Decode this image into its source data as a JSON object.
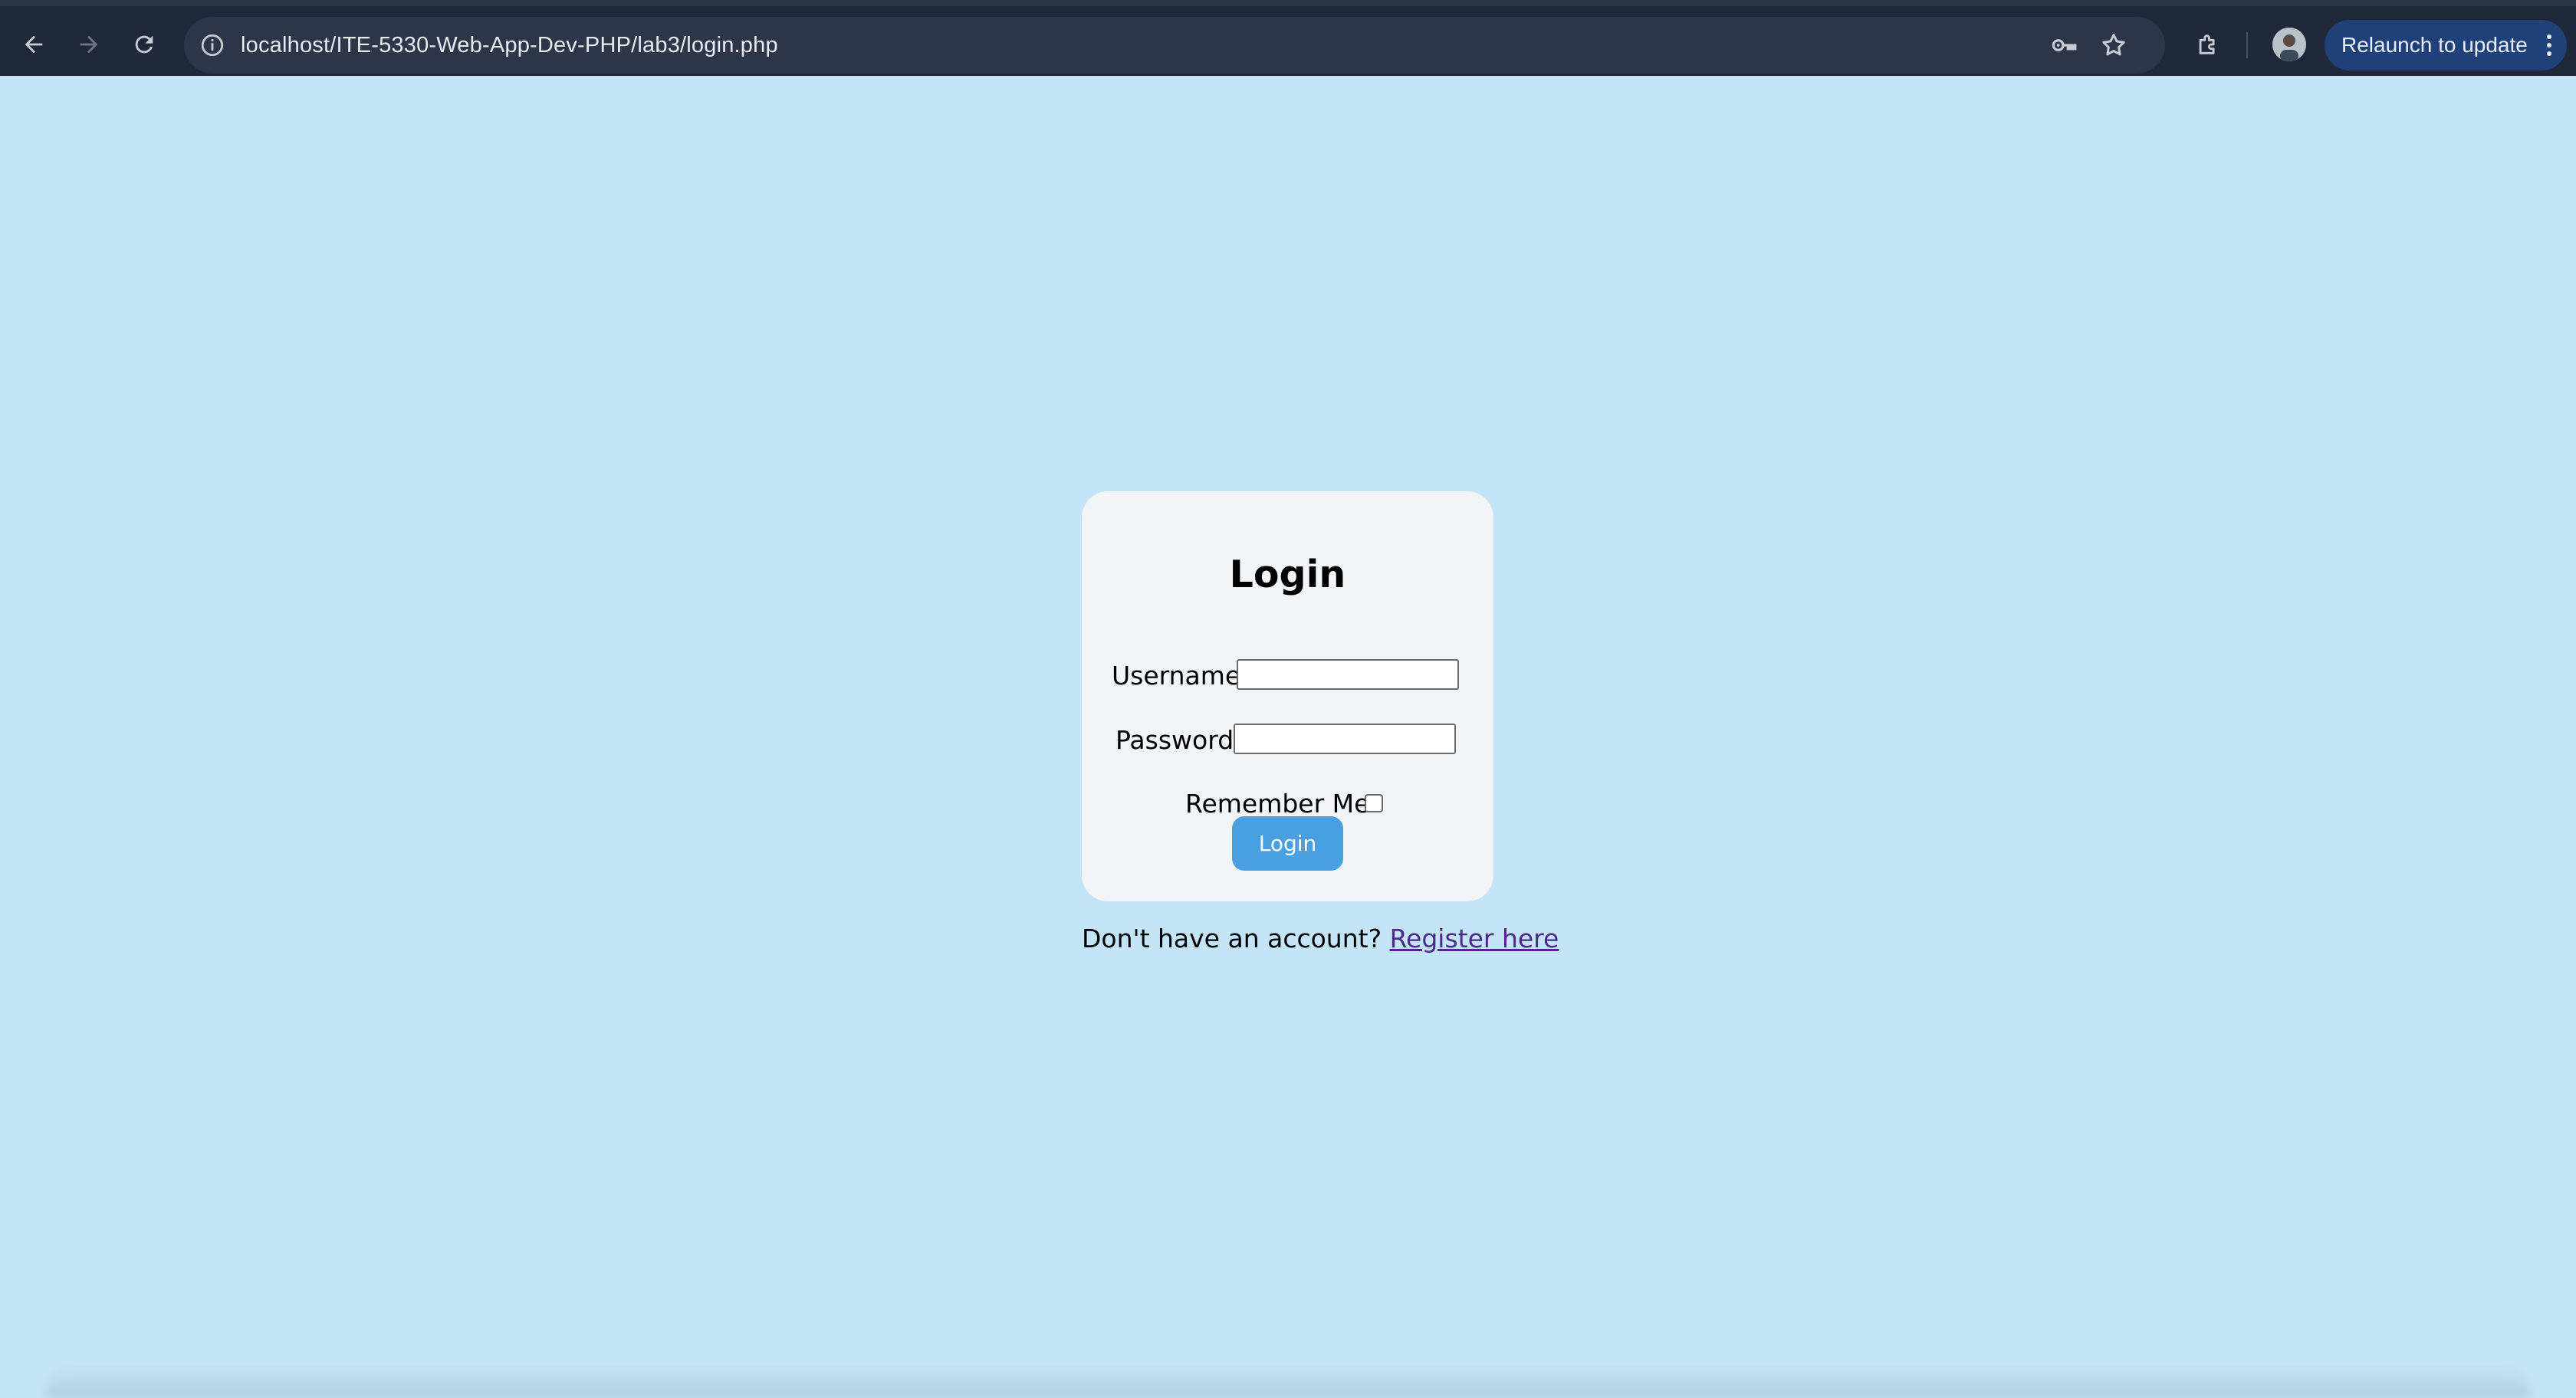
{
  "browser": {
    "url": "localhost/ITE-5330-Web-App-Dev-PHP/lab3/login.php",
    "relaunch_label": "Relaunch to update",
    "icons": [
      "back-arrow-icon",
      "forward-arrow-icon",
      "reload-icon",
      "site-info-icon",
      "password-key-icon",
      "bookmark-star-icon",
      "extensions-puzzle-icon",
      "profile-avatar",
      "more-vert-icon"
    ]
  },
  "page": {
    "background_color": "#c4e4f8",
    "card_color": "#f3f4f6",
    "accent_color": "#4a9fe0"
  },
  "login_form": {
    "title": "Login",
    "username_label": "Username:",
    "username_value": "",
    "password_label": "Password:",
    "password_value": "",
    "remember_label": "Remember Me:",
    "remember_checked": false,
    "submit_label": "Login"
  },
  "register": {
    "prompt": "Don't have an account?",
    "link_text": "Register here"
  }
}
